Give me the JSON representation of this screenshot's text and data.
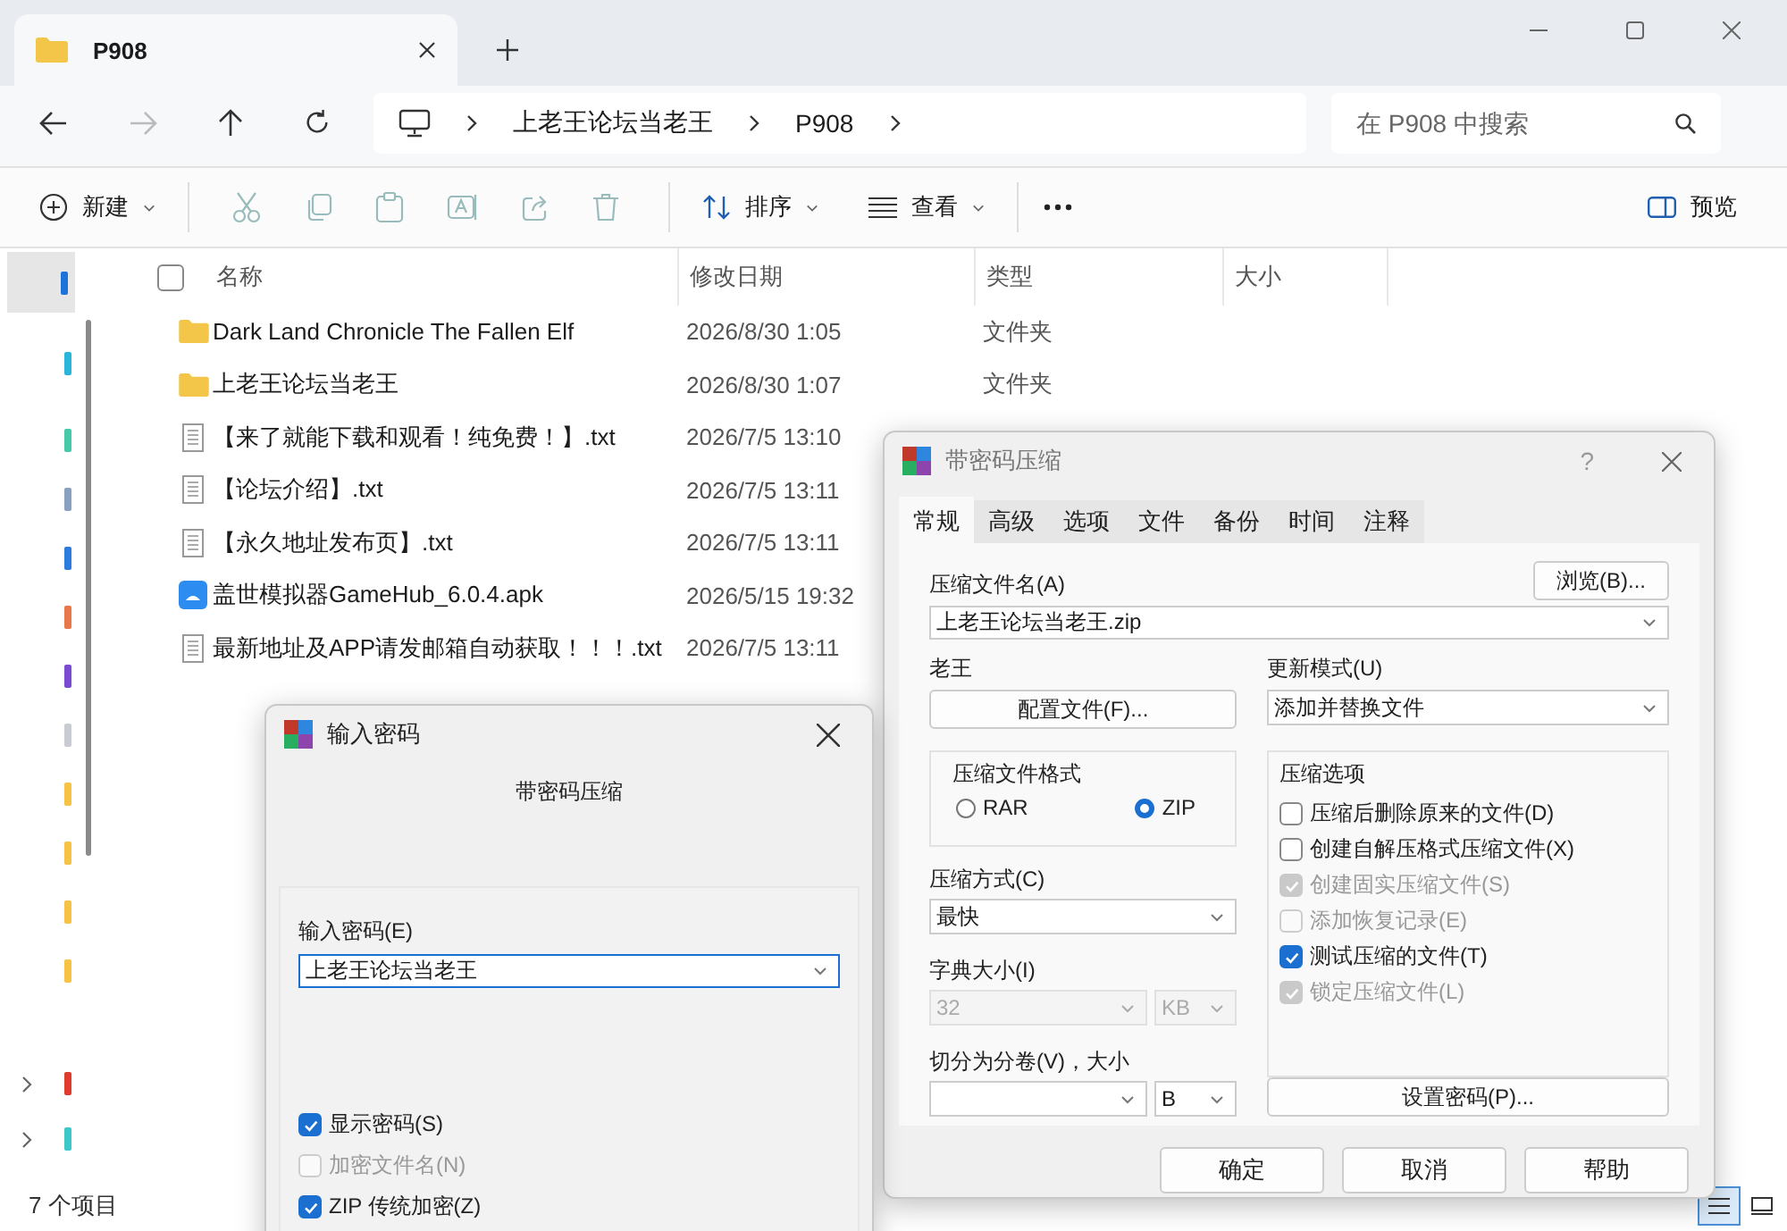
{
  "window": {
    "tab_title": "P908"
  },
  "address_bar": {
    "crumbs": [
      "上老王论坛当老王",
      "P908"
    ]
  },
  "search": {
    "placeholder": "在 P908 中搜索"
  },
  "toolbar": {
    "new": "新建",
    "sort": "排序",
    "view": "查看",
    "preview": "预览"
  },
  "file_list": {
    "select_all_checked": false,
    "columns": [
      "名称",
      "修改日期",
      "类型",
      "大小"
    ],
    "rows": [
      {
        "kind": "folder",
        "name": "Dark Land Chronicle The Fallen Elf",
        "date": "2026/8/30 1:05",
        "type": "文件夹"
      },
      {
        "kind": "folder",
        "name": "上老王论坛当老王",
        "date": "2026/8/30 1:07",
        "type": "文件夹"
      },
      {
        "kind": "text",
        "name": "【来了就能下载和观看！纯免费！】.txt",
        "date": "2026/7/5 13:10"
      },
      {
        "kind": "text",
        "name": "【论坛介绍】.txt",
        "date": "2026/7/5 13:11"
      },
      {
        "kind": "text",
        "name": "【永久地址发布页】.txt",
        "date": "2026/7/5 13:11"
      },
      {
        "kind": "apk",
        "name": "盖世模拟器GameHub_6.0.4.apk",
        "date": "2026/5/15 19:32"
      },
      {
        "kind": "text",
        "name": "最新地址及APP请发邮箱自动获取！！！.txt",
        "date": "2026/7/5 13:11"
      }
    ]
  },
  "status_bar": {
    "count": "7 个项目"
  },
  "compress_dialog": {
    "title": "带密码压缩",
    "help": "?",
    "tabs": [
      {
        "label": "常规",
        "selected": true
      },
      {
        "label": "高级",
        "selected": false
      },
      {
        "label": "选项",
        "selected": false
      },
      {
        "label": "文件",
        "selected": false
      },
      {
        "label": "备份",
        "selected": false
      },
      {
        "label": "时间",
        "selected": false
      },
      {
        "label": "注释",
        "selected": false
      }
    ],
    "archive_name_label": "压缩文件名(A)",
    "browse_button": "浏览(B)...",
    "archive_name": "上老王论坛当老王.zip",
    "profile_label": "老王",
    "profile_button": "配置文件(F)...",
    "update_mode_label": "更新模式(U)",
    "update_mode": "添加并替换文件",
    "format_group": "压缩文件格式",
    "formats": [
      {
        "label": "RAR",
        "selected": false
      },
      {
        "label": "ZIP",
        "selected": true
      }
    ],
    "method_label": "压缩方式(C)",
    "method": "最快",
    "dict_label": "字典大小(I)",
    "dict_value": "32",
    "dict_unit": "KB",
    "dict_disabled": true,
    "split_label": "切分为分卷(V)，大小",
    "split_unit": "B",
    "options_group": "压缩选项",
    "options": [
      {
        "label": "压缩后删除原来的文件(D)",
        "checked": false,
        "disabled": false
      },
      {
        "label": "创建自解压格式压缩文件(X)",
        "checked": false,
        "disabled": false
      },
      {
        "label": "创建固实压缩文件(S)",
        "checked": true,
        "disabled": true
      },
      {
        "label": "添加恢复记录(E)",
        "checked": false,
        "disabled": true
      },
      {
        "label": "测试压缩的文件(T)",
        "checked": true,
        "disabled": false
      },
      {
        "label": "锁定压缩文件(L)",
        "checked": true,
        "disabled": true
      }
    ],
    "set_password_button": "设置密码(P)...",
    "buttons": [
      "确定",
      "取消",
      "帮助"
    ]
  },
  "password_dialog": {
    "title": "输入密码",
    "subtitle": "带密码压缩",
    "field_label": "输入密码(E)",
    "password": "上老王论坛当老王",
    "options": [
      {
        "label": "显示密码(S)",
        "checked": true,
        "disabled": false
      },
      {
        "label": "加密文件名(N)",
        "checked": false,
        "disabled": true
      },
      {
        "label": "ZIP 传统加密(Z)",
        "checked": true,
        "disabled": false
      }
    ]
  }
}
